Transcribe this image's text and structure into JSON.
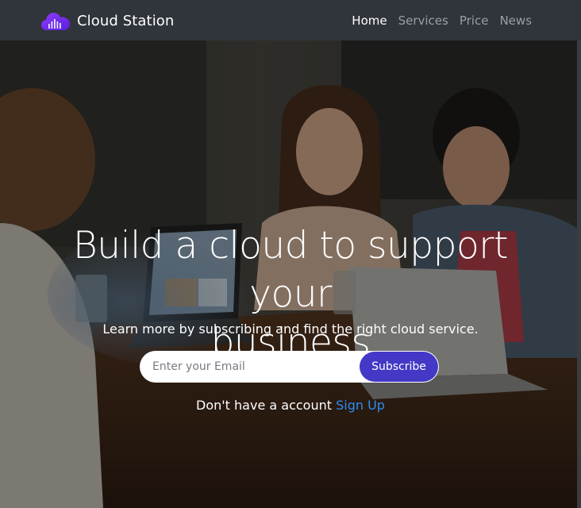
{
  "brand": {
    "name": "Cloud Station",
    "logo_icon": "cloud-bars-icon",
    "accent": "#7b2ff7"
  },
  "nav": {
    "items": [
      {
        "label": "Home",
        "active": true
      },
      {
        "label": "Services",
        "active": false
      },
      {
        "label": "Price",
        "active": false
      },
      {
        "label": "News",
        "active": false
      }
    ]
  },
  "hero": {
    "title_line1": "Build a cloud to support your",
    "title_line2": "business",
    "subtitle": "Learn more by subscribing and find the right cloud service."
  },
  "subscribe": {
    "placeholder": "Enter your Email",
    "button_label": "Subscribe",
    "button_color": "#4339c6"
  },
  "signup": {
    "prompt": "Don't have a account",
    "link_label": "Sign Up",
    "link_color": "#2f8cf0"
  }
}
